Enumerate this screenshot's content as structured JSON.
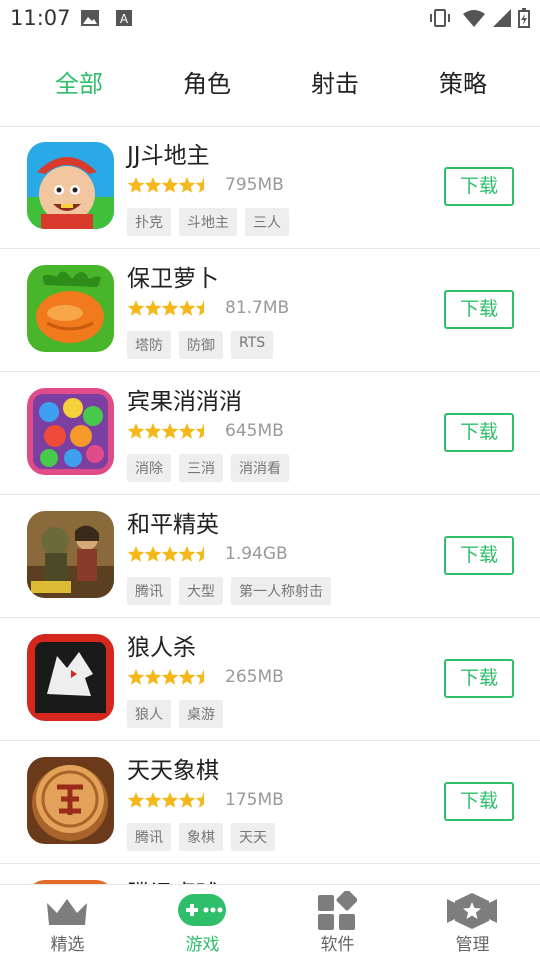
{
  "status_bar": {
    "time": "11:07"
  },
  "tabs": [
    {
      "label": "全部",
      "active": true
    },
    {
      "label": "角色",
      "active": false
    },
    {
      "label": "射击",
      "active": false
    },
    {
      "label": "策略",
      "active": false
    }
  ],
  "apps": [
    {
      "name": "JJ斗地主",
      "rating": 4.5,
      "size": "795MB",
      "tags": [
        "扑克",
        "斗地主",
        "三人"
      ],
      "button": "下载",
      "icon": "jj-doudizhu-icon"
    },
    {
      "name": "保卫萝卜",
      "rating": 4.5,
      "size": "81.7MB",
      "tags": [
        "塔防",
        "防御",
        "RTS"
      ],
      "button": "下载",
      "icon": "carrot-icon"
    },
    {
      "name": "宾果消消消",
      "rating": 4.5,
      "size": "645MB",
      "tags": [
        "消除",
        "三消",
        "消消看"
      ],
      "button": "下载",
      "icon": "candy-icon"
    },
    {
      "name": "和平精英",
      "rating": 4.5,
      "size": "1.94GB",
      "tags": [
        "腾讯",
        "大型",
        "第一人称射击"
      ],
      "button": "下载",
      "icon": "soldier-icon"
    },
    {
      "name": "狼人杀",
      "rating": 4.5,
      "size": "265MB",
      "tags": [
        "狼人",
        "桌游"
      ],
      "button": "下载",
      "icon": "werewolf-icon"
    },
    {
      "name": "天天象棋",
      "rating": 4.5,
      "size": "175MB",
      "tags": [
        "腾讯",
        "象棋",
        "天天"
      ],
      "button": "下载",
      "icon": "chess-piece-icon"
    },
    {
      "name": "腾讯桌球",
      "partial": true
    }
  ],
  "bottom_nav": [
    {
      "label": "精选",
      "icon": "crown-icon",
      "active": false
    },
    {
      "label": "游戏",
      "icon": "gamepad-icon",
      "active": true
    },
    {
      "label": "软件",
      "icon": "apps-grid-icon",
      "active": false
    },
    {
      "label": "管理",
      "icon": "hexagon-star-icon",
      "active": false
    }
  ],
  "colors": {
    "accent": "#2fbf6a",
    "star": "#f5b81b",
    "tag_bg": "#eeeeee"
  }
}
